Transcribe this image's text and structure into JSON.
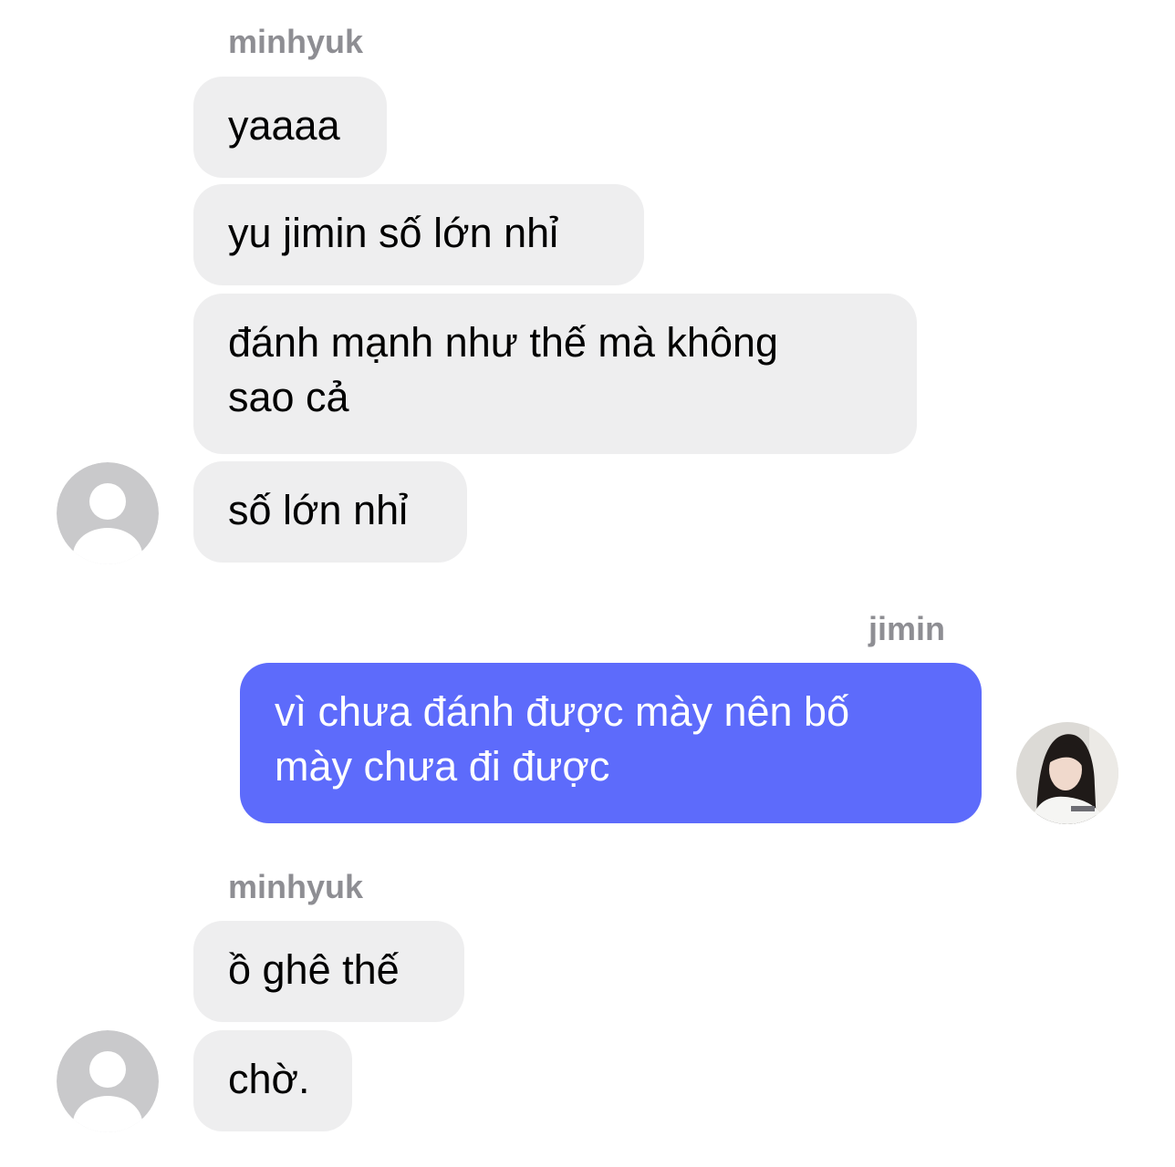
{
  "colors": {
    "incoming_bubble": "#eeeeef",
    "outgoing_bubble": "#5d6bfb",
    "sender_name": "#8e8e93",
    "placeholder_avatar": "#c9c9cb"
  },
  "groups": [
    {
      "sender": "minhyuk",
      "side": "left",
      "avatar_icon": "default-user-icon",
      "messages": [
        "yaaaa",
        "yu jimin số lớn nhỉ",
        "đánh mạnh như thế mà không\nsao cả",
        "số lớn nhỉ"
      ]
    },
    {
      "sender": "jimin",
      "side": "right",
      "avatar_icon": "profile-photo",
      "messages": [
        "vì chưa đánh được mày nên bố\nmày chưa đi được"
      ]
    },
    {
      "sender": "minhyuk",
      "side": "left",
      "avatar_icon": "default-user-icon",
      "messages": [
        "ồ ghê thế",
        "chờ."
      ]
    }
  ]
}
